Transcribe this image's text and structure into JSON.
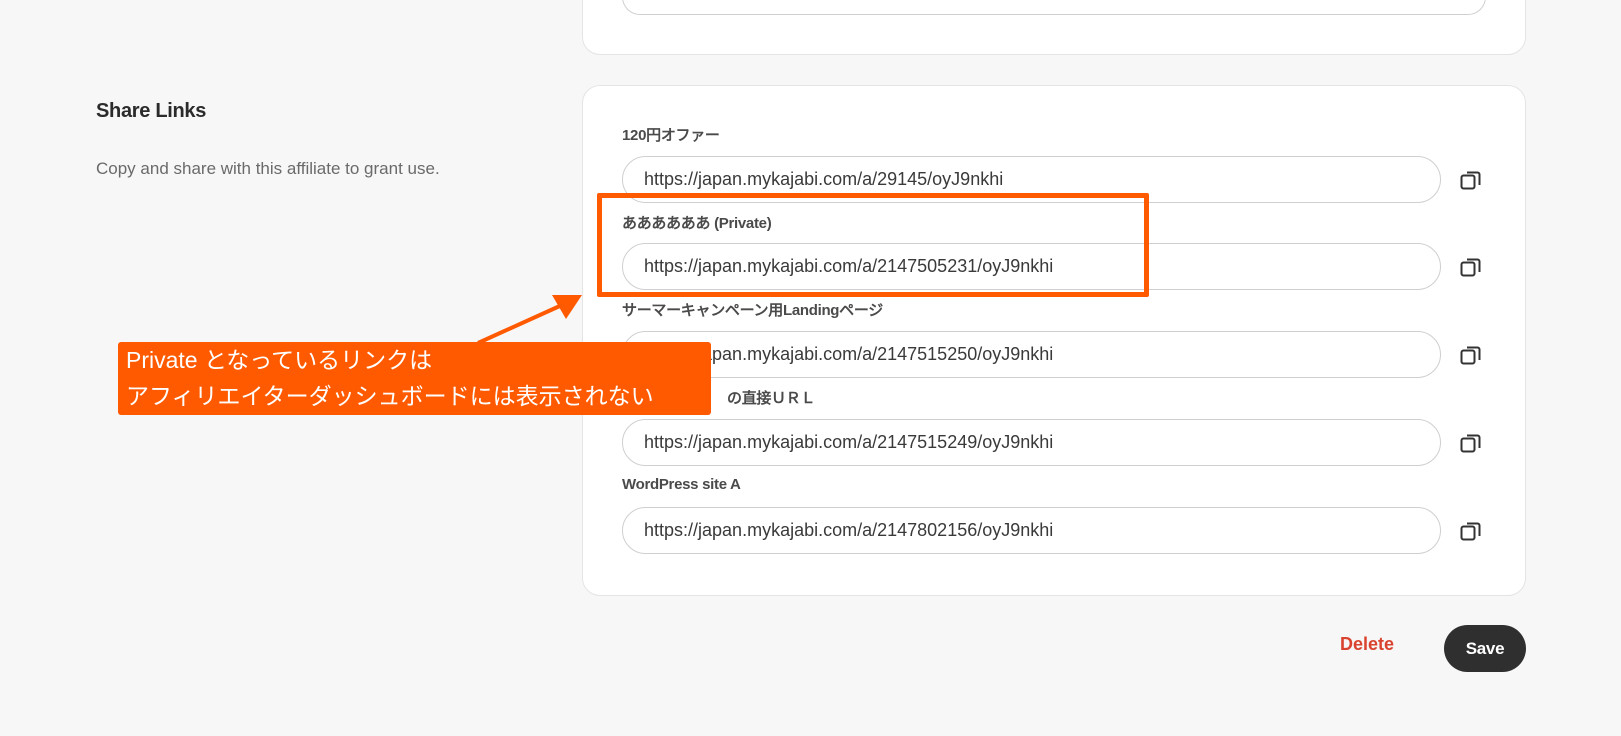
{
  "share_links": {
    "title": "Share Links",
    "description": "Copy and share with this affiliate to grant use."
  },
  "links": [
    {
      "label": "120円オファー",
      "url": "https://japan.mykajabi.com/a/29145/oyJ9nkhi"
    },
    {
      "label": "ああああああ (Private)",
      "url": "https://japan.mykajabi.com/a/2147505231/oyJ9nkhi"
    },
    {
      "label": "サーマーキャンペーン用Landingページ",
      "url": "https://japan.mykajabi.com/a/2147515250/oyJ9nkhi"
    },
    {
      "label": "の直接ＵＲＬ",
      "url": "https://japan.mykajabi.com/a/2147515249/oyJ9nkhi"
    },
    {
      "label": "WordPress site A",
      "url": "https://japan.mykajabi.com/a/2147802156/oyJ9nkhi"
    }
  ],
  "copy_icon": "copy-icon",
  "actions": {
    "delete_label": "Delete",
    "save_label": "Save"
  },
  "annotation": {
    "line1": "Private となっているリンクは",
    "line2": "アフィリエイターダッシュボードには表示されない",
    "color": "#ff5a00"
  },
  "colors": {
    "background": "#f7f7f7",
    "delete": "#d9432f",
    "save_bg": "#2f2f2f"
  }
}
